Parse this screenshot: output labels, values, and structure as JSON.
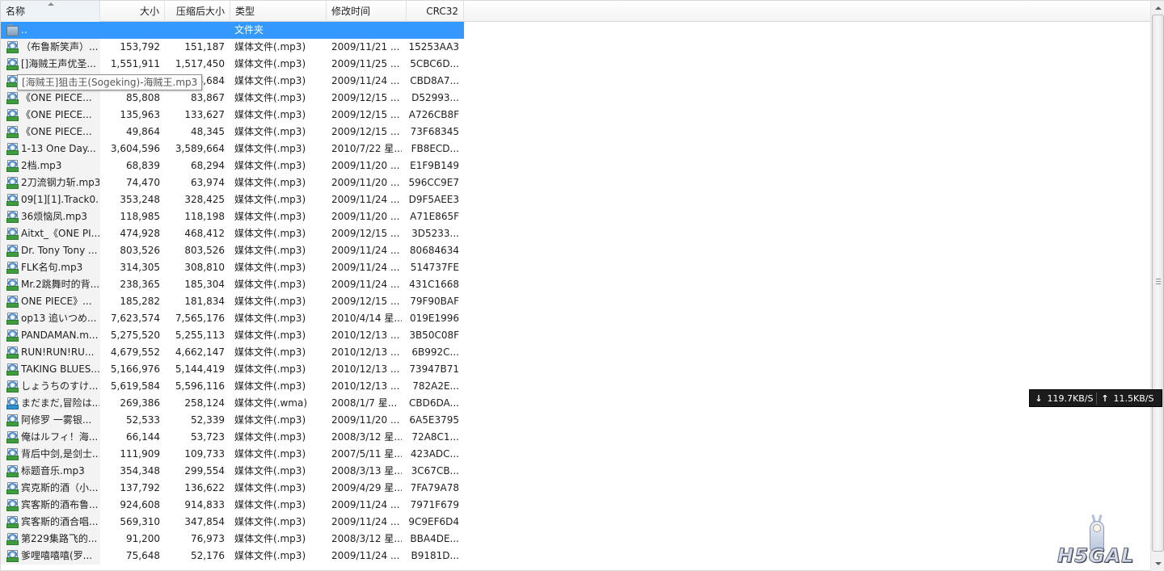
{
  "columns": {
    "name": "名称",
    "size": "大小",
    "compressed": "压缩后大小",
    "type": "类型",
    "modified": "修改时间",
    "crc": "CRC32"
  },
  "parent_row": {
    "name": "..",
    "type": "文件夹"
  },
  "rows": [
    {
      "name": "（布鲁斯笑声）...",
      "size": "153,792",
      "compressed": "151,187",
      "type": "媒体文件(.mp3)",
      "modified": "2009/11/21 ...",
      "crc": "15253AA3"
    },
    {
      "name": "[]海贼王声优圣...",
      "size": "1,551,911",
      "compressed": "1,517,450",
      "type": "媒体文件(.mp3)",
      "modified": "2009/11/25 ...",
      "crc": "5CBC6D..."
    },
    {
      "name": "[海贼王]狙击王...",
      "size": "",
      "compressed": "8,684",
      "type": "媒体文件(.mp3)",
      "modified": "2009/11/24 ...",
      "crc": "CBD8A7..."
    },
    {
      "name": "《ONE PIECE...",
      "size": "85,808",
      "compressed": "83,867",
      "type": "媒体文件(.mp3)",
      "modified": "2009/12/15 ...",
      "crc": "D52993..."
    },
    {
      "name": "《ONE PIECE...",
      "size": "135,963",
      "compressed": "133,627",
      "type": "媒体文件(.mp3)",
      "modified": "2009/12/15 ...",
      "crc": "A726CB8F"
    },
    {
      "name": "《ONE PIECE...",
      "size": "49,864",
      "compressed": "48,345",
      "type": "媒体文件(.mp3)",
      "modified": "2009/12/15 ...",
      "crc": "73F68345"
    },
    {
      "name": "1-13 One Day...",
      "size": "3,604,596",
      "compressed": "3,589,664",
      "type": "媒体文件(.mp3)",
      "modified": "2010/7/22 星...",
      "crc": "FB8ECD..."
    },
    {
      "name": "2档.mp3",
      "size": "68,839",
      "compressed": "68,294",
      "type": "媒体文件(.mp3)",
      "modified": "2009/11/20 ...",
      "crc": "E1F9B149"
    },
    {
      "name": "2刀流钢力斩.mp3",
      "size": "74,470",
      "compressed": "63,974",
      "type": "媒体文件(.mp3)",
      "modified": "2009/11/20 ...",
      "crc": "596CC9E7"
    },
    {
      "name": "09[1][1].Track0...",
      "size": "353,248",
      "compressed": "328,425",
      "type": "媒体文件(.mp3)",
      "modified": "2009/11/24 ...",
      "crc": "D9F5AEE3"
    },
    {
      "name": "36烦恼凤.mp3",
      "size": "118,985",
      "compressed": "118,198",
      "type": "媒体文件(.mp3)",
      "modified": "2009/11/20 ...",
      "crc": "A71E865F"
    },
    {
      "name": "Aitxt_《ONE PI...",
      "size": "474,928",
      "compressed": "468,412",
      "type": "媒体文件(.mp3)",
      "modified": "2009/12/15 ...",
      "crc": "3D5233..."
    },
    {
      "name": "Dr. Tony Tony ...",
      "size": "803,526",
      "compressed": "803,526",
      "type": "媒体文件(.mp3)",
      "modified": "2009/11/24 ...",
      "crc": "80684634"
    },
    {
      "name": "FLK名句.mp3",
      "size": "314,305",
      "compressed": "308,810",
      "type": "媒体文件(.mp3)",
      "modified": "2009/11/24 ...",
      "crc": "514737FE"
    },
    {
      "name": "Mr.2跳舞时的背...",
      "size": "238,365",
      "compressed": "185,304",
      "type": "媒体文件(.mp3)",
      "modified": "2009/11/24 ...",
      "crc": "431C1668"
    },
    {
      "name": "ONE PIECE》...",
      "size": "185,282",
      "compressed": "181,834",
      "type": "媒体文件(.mp3)",
      "modified": "2009/12/15 ...",
      "crc": "79F90BAF"
    },
    {
      "name": "op13 追いつめ...",
      "size": "7,623,574",
      "compressed": "7,565,176",
      "type": "媒体文件(.mp3)",
      "modified": "2010/4/14 星...",
      "crc": "019E1996"
    },
    {
      "name": "PANDAMAN.m...",
      "size": "5,275,520",
      "compressed": "5,255,113",
      "type": "媒体文件(.mp3)",
      "modified": "2010/12/13 ...",
      "crc": "3B50C08F"
    },
    {
      "name": "RUN!RUN!RU...",
      "size": "4,679,552",
      "compressed": "4,662,147",
      "type": "媒体文件(.mp3)",
      "modified": "2010/12/13 ...",
      "crc": "6B992C..."
    },
    {
      "name": "TAKING BLUES...",
      "size": "5,166,976",
      "compressed": "5,144,419",
      "type": "媒体文件(.mp3)",
      "modified": "2010/12/13 ...",
      "crc": "73947B71"
    },
    {
      "name": "しょうちのすけ...",
      "size": "5,619,584",
      "compressed": "5,596,116",
      "type": "媒体文件(.mp3)",
      "modified": "2010/12/13 ...",
      "crc": "782A2E..."
    },
    {
      "name": "まだまだ,冒险は...",
      "size": "269,386",
      "compressed": "258,124",
      "type": "媒体文件(.wma)",
      "modified": "2008/1/7 星...",
      "crc": "CBD6DA...",
      "wma": true
    },
    {
      "name": "阿修罗 一雾银...",
      "size": "52,533",
      "compressed": "52,339",
      "type": "媒体文件(.mp3)",
      "modified": "2009/11/20 ...",
      "crc": "6A5E3795"
    },
    {
      "name": "俺はルフィ！海...",
      "size": "66,144",
      "compressed": "53,723",
      "type": "媒体文件(.mp3)",
      "modified": "2008/3/12 星...",
      "crc": "72A8C1..."
    },
    {
      "name": "背后中剑,是剑士...",
      "size": "111,909",
      "compressed": "109,733",
      "type": "媒体文件(.mp3)",
      "modified": "2007/5/11 星...",
      "crc": "423ADC..."
    },
    {
      "name": "标题音乐.mp3",
      "size": "354,348",
      "compressed": "299,554",
      "type": "媒体文件(.mp3)",
      "modified": "2008/3/13 星...",
      "crc": "3C67CB..."
    },
    {
      "name": "宾克斯的酒（小...",
      "size": "137,792",
      "compressed": "136,622",
      "type": "媒体文件(.mp3)",
      "modified": "2009/4/29 星...",
      "crc": "7FA79A78"
    },
    {
      "name": "宾客斯的酒布鲁...",
      "size": "924,608",
      "compressed": "914,833",
      "type": "媒体文件(.mp3)",
      "modified": "2009/11/24 ...",
      "crc": "7971F679"
    },
    {
      "name": "宾客斯的酒合唱...",
      "size": "569,310",
      "compressed": "347,854",
      "type": "媒体文件(.mp3)",
      "modified": "2009/11/24 ...",
      "crc": "9C9EF6D4"
    },
    {
      "name": "第229集路飞的...",
      "size": "91,200",
      "compressed": "76,973",
      "type": "媒体文件(.mp3)",
      "modified": "2008/3/12 星...",
      "crc": "BBA4DE..."
    },
    {
      "name": "爹哩嘻嘻嘻(罗...",
      "size": "75,648",
      "compressed": "52,176",
      "type": "媒体文件(.mp3)",
      "modified": "2009/11/24 ...",
      "crc": "B9181D..."
    }
  ],
  "tooltip": "[海贼王]狙击王(Sogeking)-海贼王.mp3",
  "speed_widget": {
    "download": "119.7KB/S",
    "upload": "11.5KB/S",
    "down_icon": "arrow-down-icon",
    "up_icon": "arrow-up-icon"
  },
  "watermark": {
    "text": "H5GAL"
  },
  "colors": {
    "selection": "#3399ff",
    "name_column_bg": "#f3f3f3",
    "speed_bg": "#1c1c1c",
    "mp3_icon_band": "#3e9b3e",
    "wma_icon_band": "#2f8fd0"
  },
  "icons": {
    "file": "mp3-file-icon",
    "folder": "folder-up-icon"
  }
}
